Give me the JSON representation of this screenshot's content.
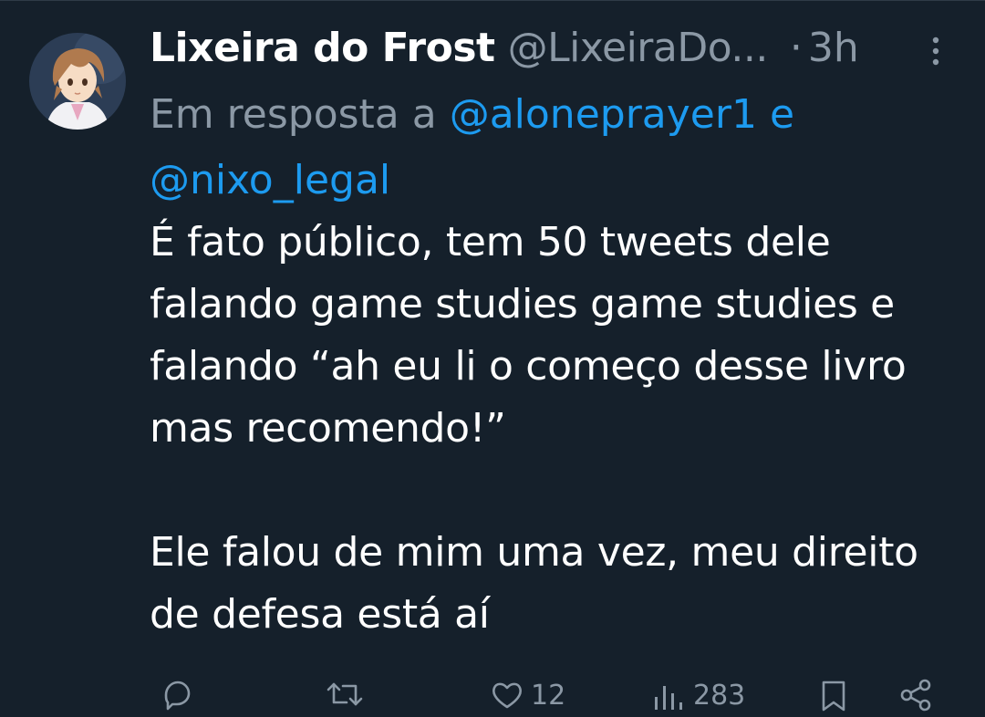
{
  "tweet": {
    "author": {
      "display_name": "Lixeira do Frost",
      "handle": "@LixeiraDo..."
    },
    "separator": "·",
    "time": "3h",
    "reply_prefix": "Em resposta a",
    "reply_mentions": [
      "@aloneprayer1",
      "@nixo_legal"
    ],
    "reply_conjunction": "e",
    "body": [
      "É fato público, tem 50 tweets dele falando game studies game studies e falando “ah eu li o começo desse livro mas recomendo!”",
      "Ele falou de mim uma vez, meu direito de defesa está aí"
    ],
    "stats": {
      "replies": "",
      "retweets": "",
      "likes": "12",
      "views": "283"
    }
  },
  "icons": {
    "more": "more-vertical-icon",
    "reply": "reply-icon",
    "retweet": "retweet-icon",
    "like": "heart-icon",
    "views": "views-icon",
    "bookmark": "bookmark-icon",
    "share": "share-icon"
  },
  "colors": {
    "background": "#15202b",
    "primary_text": "#ffffff",
    "secondary_text": "#8b98a5",
    "link": "#1d9bf0"
  }
}
